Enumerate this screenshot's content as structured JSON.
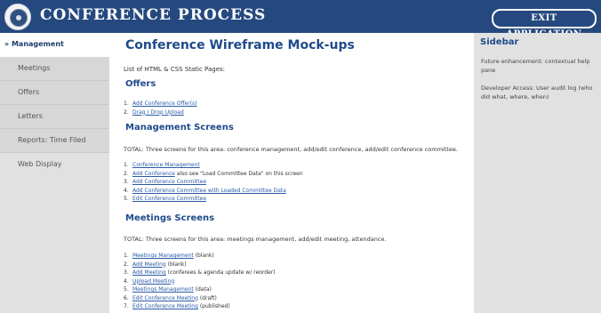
{
  "header": {
    "app_title": "CONFERENCE PROCESS",
    "exit_label": "EXIT APPLICATION"
  },
  "nav": {
    "items": [
      {
        "label": "» Management"
      },
      {
        "label": "Meetings"
      },
      {
        "label": "Offers"
      },
      {
        "label": "Letters"
      },
      {
        "label": "Reports: Time Filed"
      },
      {
        "label": "Web Display"
      }
    ]
  },
  "main": {
    "title": "Conference Wireframe Mock-ups",
    "intro": "List of HTML & CSS Static Pages:",
    "offers": {
      "heading": "Offers",
      "items": [
        {
          "num": "1.",
          "link": "Add Conference Offer(s)",
          "suffix": ""
        },
        {
          "num": "2.",
          "link": "Drag / Drop Upload",
          "suffix": ""
        }
      ]
    },
    "management": {
      "heading": "Management Screens",
      "total": "TOTAL: Three screens for this area: conference management, add/edit conference, add/edit conference committee.",
      "items": [
        {
          "num": "1.",
          "link": "Conference Management",
          "suffix": ""
        },
        {
          "num": "2.",
          "link": "Add Conference",
          "suffix": " also see \"Load Committee Data\" on this screen"
        },
        {
          "num": "3.",
          "link": "Add Conference Committee",
          "suffix": ""
        },
        {
          "num": "4.",
          "link": "Add Conference Committee with Loaded Committee Data",
          "suffix": ""
        },
        {
          "num": "5.",
          "link": "Edit Conference Committee",
          "suffix": ""
        }
      ]
    },
    "meetings": {
      "heading": "Meetings Screens",
      "total": "TOTAL: Three screens for this area: meetings management, add/edit meeting, attendance.",
      "items": [
        {
          "num": "1.",
          "link": "Meetings Management",
          "suffix": " (blank)"
        },
        {
          "num": "2.",
          "link": "Add Meeting",
          "suffix": " (blank)"
        },
        {
          "num": "3.",
          "link": "Add Meeting",
          "suffix": " (conferees & agenda update w/ reorder)"
        },
        {
          "num": "4.",
          "link": "Upload Meeting",
          "suffix": ""
        },
        {
          "num": "5.",
          "link": "Meetings Management",
          "suffix": " (data)"
        },
        {
          "num": "6.",
          "link": "Edit Conference Meeting",
          "suffix": " (draft)"
        },
        {
          "num": "7.",
          "link": "Edit Conference Meeting",
          "suffix": " (published)"
        }
      ]
    }
  },
  "sidebar": {
    "title": "Sidebar",
    "text1": "Future enhancement: contextual help pane",
    "text2": "Developer Access: User audit log (who did what, where, when)"
  }
}
